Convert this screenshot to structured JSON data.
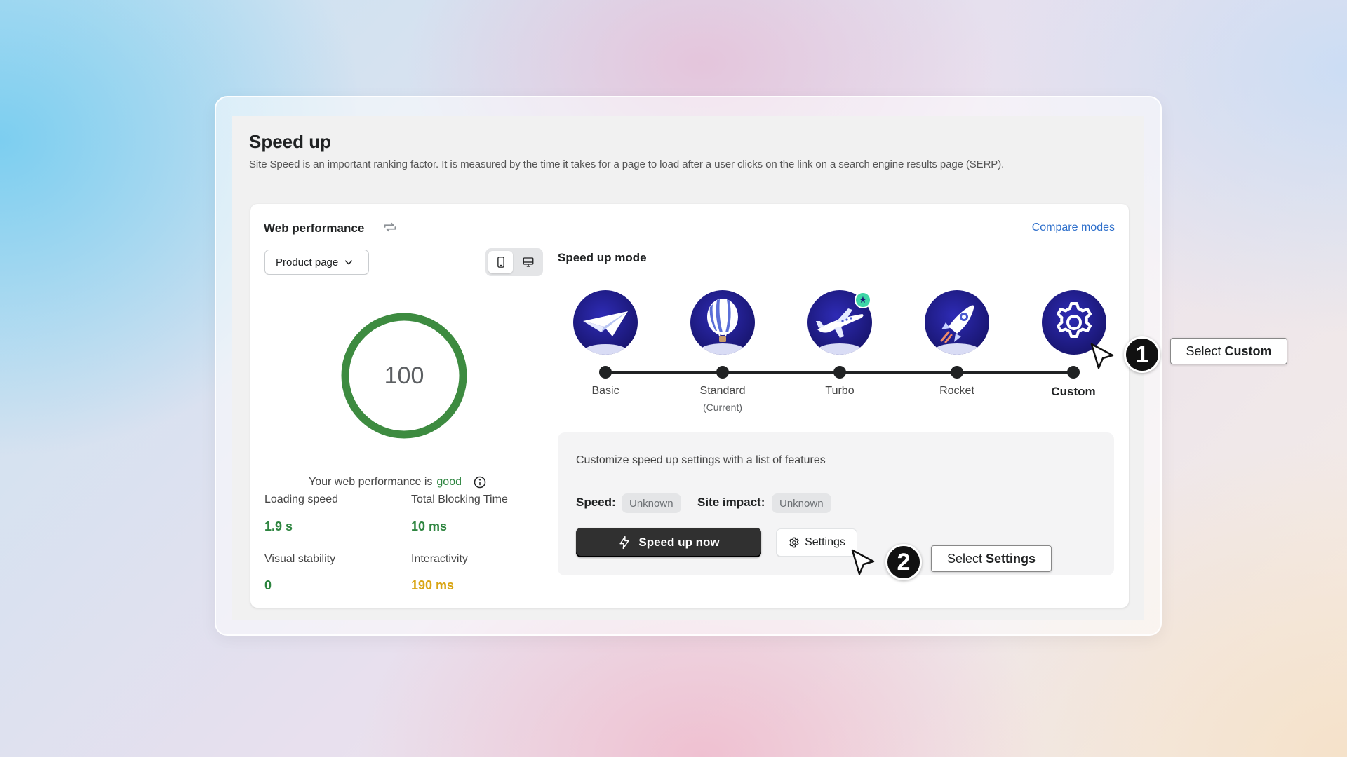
{
  "page": {
    "title": "Speed up",
    "description": "Site Speed is an important ranking factor. It is measured by the time it takes for a page to load after a user clicks on the link on a search engine results page (SERP)."
  },
  "web_performance": {
    "title": "Web performance",
    "refresh_icon": "refresh-icon",
    "compare_link": "Compare modes",
    "page_select": "Product page",
    "device_icons": [
      "mobile-icon",
      "desktop-icon"
    ],
    "score": "100",
    "score_color": "#3d8b40",
    "status_prefix": "Your web performance is",
    "status_word": "good",
    "metrics": [
      {
        "label": "Loading speed",
        "value": "1.9 s",
        "color": "#2e8540"
      },
      {
        "label": "Total Blocking Time",
        "value": "10 ms",
        "color": "#2e8540"
      },
      {
        "label": "Visual stability",
        "value": "0",
        "color": "#2e8540"
      },
      {
        "label": "Interactivity",
        "value": "190 ms",
        "color": "#d9a513"
      }
    ]
  },
  "speed_mode": {
    "title": "Speed up mode",
    "modes": [
      {
        "label": "Basic",
        "sub": "",
        "icon": "paper-plane-icon"
      },
      {
        "label": "Standard",
        "sub": "(Current)",
        "icon": "hot-air-balloon-icon"
      },
      {
        "label": "Turbo",
        "sub": "",
        "icon": "airplane-icon"
      },
      {
        "label": "Rocket",
        "sub": "",
        "icon": "rocket-icon"
      },
      {
        "label": "Custom",
        "sub": "",
        "icon": "gear-icon"
      }
    ],
    "custom_description": "Customize speed up settings with a list of features",
    "speed_label": "Speed:",
    "speed_value": "Unknown",
    "impact_label": "Site impact:",
    "impact_value": "Unknown",
    "speed_up_button": "Speed up now",
    "settings_button": "Settings"
  },
  "callouts": [
    {
      "number": "1",
      "prefix": "Select",
      "target": "Custom"
    },
    {
      "number": "2",
      "prefix": "Select",
      "target": "Settings"
    }
  ]
}
